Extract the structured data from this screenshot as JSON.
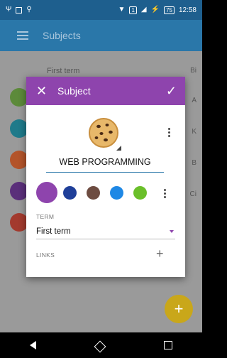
{
  "status_bar": {
    "time": "12:58",
    "sim_label": "1",
    "battery": "75"
  },
  "app_bar": {
    "title": "Subjects"
  },
  "background_list": {
    "term_header": "First term",
    "right_labels": [
      "Bi",
      "A",
      "K",
      "B",
      "Ci"
    ]
  },
  "dialog": {
    "title": "Subject",
    "subject_name": "WEB PROGRAMMING",
    "colors": {
      "swatches": [
        "#8e44ad",
        "#1f3f99",
        "#6d4c41",
        "#1e88e5",
        "#6abf2a"
      ],
      "selected": "#8e44ad"
    },
    "term": {
      "label": "TERM",
      "value": "First term"
    },
    "links": {
      "label": "LINKS"
    }
  },
  "icons": {
    "close": "close-icon",
    "confirm": "check-icon",
    "more": "more-vert-icon",
    "add": "add-icon",
    "menu": "menu-icon"
  }
}
